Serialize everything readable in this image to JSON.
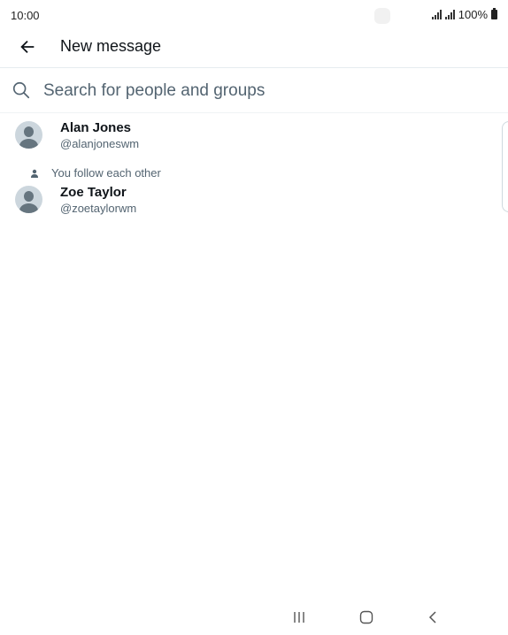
{
  "status_bar": {
    "time": "10:00",
    "battery": "100%",
    "icons": [
      "signal-icon",
      "signal-icon",
      "battery-icon"
    ]
  },
  "header": {
    "title": "New message",
    "back_icon": "arrow-left-icon"
  },
  "search": {
    "placeholder": "Search for people and groups",
    "value": "",
    "icon": "search-icon"
  },
  "contacts": [
    {
      "name": "Alan Jones",
      "handle": "@alanjoneswm"
    },
    {
      "name": "Zoe Taylor",
      "handle": "@zoetaylorwm",
      "note": "You follow each other"
    }
  ],
  "nav_bar": {
    "icons": [
      "recent-apps-icon",
      "home-icon",
      "back-icon"
    ]
  },
  "colors": {
    "text_primary": "#0f1419",
    "text_secondary": "#536471",
    "divider": "#eff3f4",
    "avatar_bg": "#ccd6dd",
    "avatar_fg": "#66757f"
  }
}
